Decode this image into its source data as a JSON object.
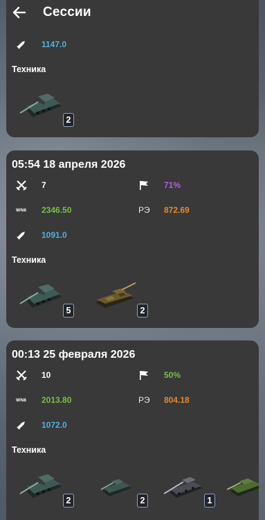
{
  "appbar": {
    "title": "Сессии"
  },
  "labels": {
    "vehicles": "Техника",
    "wn8": "WN8",
    "re": "РЭ"
  },
  "colors": {
    "card_bg": "#393939",
    "green": "#76c043",
    "purple": "#b05ee8",
    "orange": "#e08b2c",
    "blue": "#4fb0e0"
  },
  "sessions": [
    {
      "date": "",
      "avg_damage": "1147.0",
      "vehicles": [
        {
          "icon": "heavy-tank-icon",
          "count": "2"
        }
      ]
    },
    {
      "date": "05:54 18 апреля 2026",
      "battles": "7",
      "winrate": "71%",
      "wn8": "2346.50",
      "re": "872.69",
      "avg_damage": "1091.0",
      "vehicles": [
        {
          "icon": "heavy-tank-icon",
          "count": "5"
        },
        {
          "icon": "camo-tank-icon",
          "count": "2"
        }
      ]
    },
    {
      "date": "00:13 25 февраля 2026",
      "battles": "10",
      "winrate": "50%",
      "wn8": "2013.80",
      "re": "804.18",
      "avg_damage": "1072.0",
      "vehicles": [
        {
          "icon": "heavy-tank-icon",
          "count": "2"
        },
        {
          "icon": "medium-tank-icon",
          "count": "2"
        },
        {
          "icon": "light-tank-icon",
          "count": "1"
        },
        {
          "icon": "green-tank-icon",
          "count": ""
        }
      ]
    }
  ]
}
